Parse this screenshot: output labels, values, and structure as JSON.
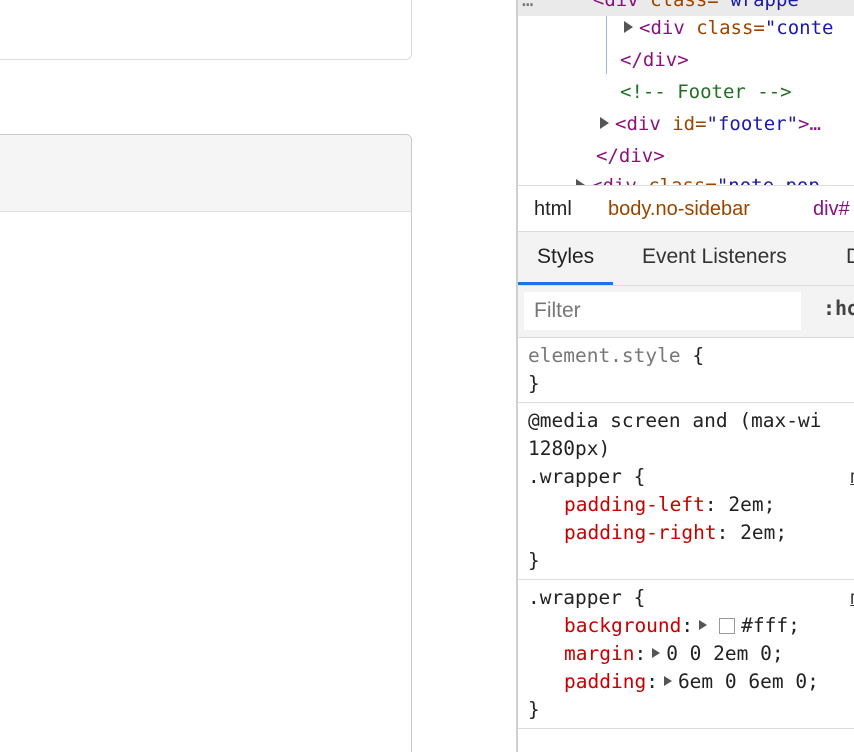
{
  "tree": {
    "rows": [
      {
        "open": "<div ",
        "attr": "class=",
        "val": "\"wrappe"
      },
      {
        "open": "<div ",
        "attr": "class=",
        "val": "\"conte"
      },
      {
        "close": "</div>"
      },
      {
        "comment": "<!-- Footer -->"
      },
      {
        "open": "<div ",
        "attr": "id=",
        "val": "\"footer\"",
        "tail": ">…"
      },
      {
        "close": "</div>"
      },
      {
        "open": "<div ",
        "attr": "class=",
        "val": "\"note-pop"
      }
    ]
  },
  "breadcrumb": [
    "html",
    "body.no-sidebar",
    "div#"
  ],
  "tabs": [
    "Styles",
    "Event Listeners",
    "D"
  ],
  "filter": {
    "placeholder": "Filter",
    "hov": ":ho"
  },
  "rules": {
    "element_style": {
      "selector": "element.style",
      "open": " {",
      "close": "}"
    },
    "media": {
      "query_line1": "@media screen and (max-wi",
      "query_line2": "1280px)",
      "selector": ".wrapper {",
      "source": "m",
      "props": [
        {
          "name": "padding-left",
          "value": ": 2em;"
        },
        {
          "name": "padding-right",
          "value": ": 2em;"
        }
      ],
      "close": "}"
    },
    "wrapper": {
      "selector": ".wrapper {",
      "source": "m",
      "props": [
        {
          "name": "background",
          "value": "#fff;",
          "swatch": "#ffffff"
        },
        {
          "name": "margin",
          "value": "0 0 2em 0;"
        },
        {
          "name": "padding",
          "value": "6em 0 6em 0;"
        }
      ],
      "close": "}"
    }
  }
}
